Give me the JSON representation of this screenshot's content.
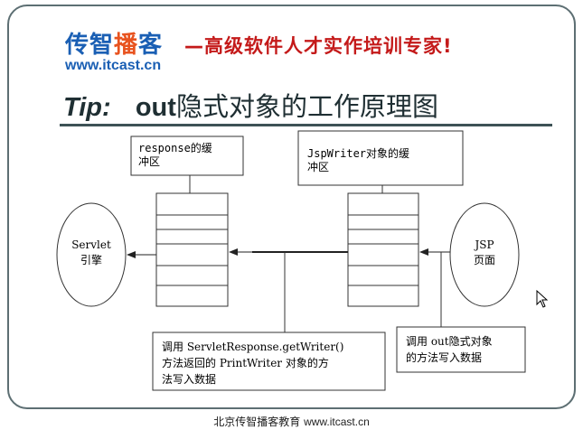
{
  "logo": {
    "name_part1": "传智",
    "name_part2": "播",
    "name_part3": "客",
    "url": "www.itcast.cn"
  },
  "slogan": "—高级软件人才实作培训专家!",
  "title": {
    "tip": "Tip:",
    "out": "out",
    "rest": "隐式对象的工作原理图"
  },
  "diagram": {
    "response_buffer_label_line1": "response的缓",
    "response_buffer_label_line2": "冲区",
    "jspwriter_buffer_label_line1": "JspWriter对象的缓",
    "jspwriter_buffer_label_line2": "冲区",
    "servlet_engine_line1": "Servlet",
    "servlet_engine_line2": "引擎",
    "jsp_page_line1": "JSP",
    "jsp_page_line2": "页面",
    "left_note_line1": "调用 ServletResponse.getWriter()",
    "left_note_line2": "方法返回的 PrintWriter 对象的方",
    "left_note_line3": "法写入数据",
    "right_note_line1": "调用 out隐式对象",
    "right_note_line2": "的方法写入数据"
  },
  "footer": {
    "cn": "北京传智播客教育 ",
    "url": "www.itcast.cn"
  }
}
